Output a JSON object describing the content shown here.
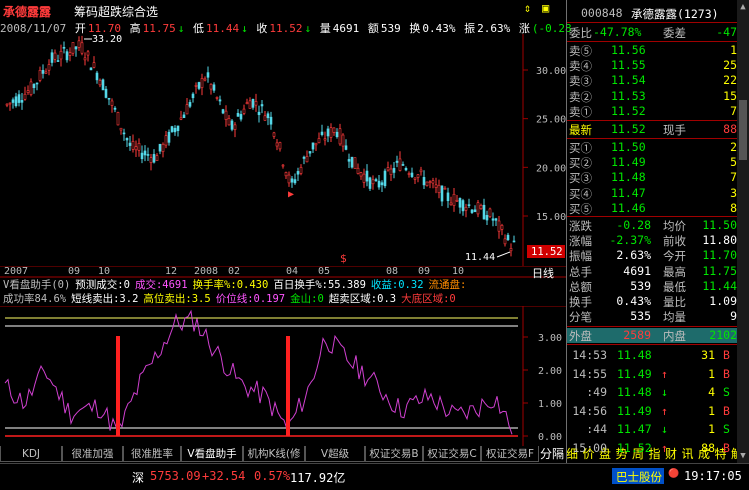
{
  "title": {
    "name": "承德露露",
    "indicator": "筹码超跌综合选"
  },
  "infobar": {
    "date": "2008/11/07",
    "open_label": "开",
    "open": "11.70",
    "high_label": "高",
    "high": "11.75",
    "low_label": "低",
    "low": "11.44",
    "close_label": "收",
    "close": "11.52",
    "vol_label": "量",
    "vol": "4691",
    "amt_label": "额",
    "amt": "539",
    "turn_label": "换",
    "turn": "0.43%",
    "amp_label": "振",
    "amp": "2.63%",
    "chg_label": "涨",
    "chg": "(-0.28"
  },
  "price_axis": [
    "30.00",
    "25.00",
    "20.00",
    "15.00"
  ],
  "price_marks": {
    "high_label": "33.20",
    "low_label": "11.44",
    "current_label": "11.52"
  },
  "date_axis": [
    "2007",
    "09",
    "10",
    "12",
    "2008",
    "02",
    "04",
    "05",
    "08",
    "09",
    "10"
  ],
  "period_label": "日线",
  "ind_info": {
    "line1": [
      {
        "t": "V看盘助手(0)",
        "c": "grey"
      },
      {
        "t": "预测成交:0",
        "c": "white"
      },
      {
        "t": "成交:4691",
        "c": "mag"
      },
      {
        "t": "换手率%:0.430",
        "c": "yellow"
      },
      {
        "t": "百日换手%:55.389",
        "c": "white"
      },
      {
        "t": "收益:0.32",
        "c": "cyan"
      },
      {
        "t": "流通盘:",
        "c": "orange"
      }
    ],
    "line2": [
      {
        "t": "成功率84.6%",
        "c": "grey"
      },
      {
        "t": "短线卖出:3.2",
        "c": "white"
      },
      {
        "t": "高位卖出:3.5",
        "c": "yellow"
      },
      {
        "t": "价位线:0.197",
        "c": "mag"
      },
      {
        "t": "金山:0",
        "c": "green"
      },
      {
        "t": "超卖区域:0.3",
        "c": "white"
      },
      {
        "t": "大底区域:0",
        "c": "red"
      }
    ]
  },
  "ind_axis": [
    "3.00",
    "2.00",
    "1.00",
    "0.00"
  ],
  "tabs": [
    "KDJ",
    "很准加强",
    "很准胜率",
    "V看盘助手",
    "机构K线(修",
    "V超级MACD",
    "权证交易B",
    "权证交易C",
    "权证交易F"
  ],
  "right_tabs": [
    "分隔",
    "细",
    "价",
    "盘",
    "势",
    "周",
    "指",
    "财",
    "讯",
    "成",
    "特",
    "解"
  ],
  "status": {
    "market": "深",
    "index": "5753.09",
    "change": "+32.54",
    "pct": "0.57%",
    "amount": "117.92亿",
    "ticker_name": "巴士股份",
    "time": "19:17:05"
  },
  "quote": {
    "code": "000848",
    "name": "承德露露(1273)",
    "weibi_label": "委比",
    "weibi": "-47.78%",
    "weicha_label": "委差",
    "weicha": "-47",
    "asks": [
      {
        "label": "卖⑤",
        "price": "11.56",
        "vol": "1"
      },
      {
        "label": "卖④",
        "price": "11.55",
        "vol": "25"
      },
      {
        "label": "卖③",
        "price": "11.54",
        "vol": "22"
      },
      {
        "label": "卖②",
        "price": "11.53",
        "vol": "15"
      },
      {
        "label": "卖①",
        "price": "11.52",
        "vol": "7"
      }
    ],
    "last_label": "最新",
    "last": "11.52",
    "curhand_label": "现手",
    "curhand": "88",
    "bids": [
      {
        "label": "买①",
        "price": "11.50",
        "vol": "2"
      },
      {
        "label": "买②",
        "price": "11.49",
        "vol": "5"
      },
      {
        "label": "买③",
        "price": "11.48",
        "vol": "7"
      },
      {
        "label": "买④",
        "price": "11.47",
        "vol": "3"
      },
      {
        "label": "买⑤",
        "price": "11.46",
        "vol": "8"
      }
    ],
    "stats": [
      {
        "l1": "涨跌",
        "v1": "-0.28",
        "l2": "均价",
        "v2": "11.50",
        "c1": "green",
        "c2": "green"
      },
      {
        "l1": "涨幅",
        "v1": "-2.37%",
        "l2": "前收",
        "v2": "11.80",
        "c1": "green",
        "c2": "white"
      },
      {
        "l1": "振幅",
        "v1": "2.63%",
        "l2": "今开",
        "v2": "11.70",
        "c1": "white",
        "c2": "green"
      },
      {
        "l1": "总手",
        "v1": "4691",
        "l2": "最高",
        "v2": "11.75",
        "c1": "white",
        "c2": "green"
      },
      {
        "l1": "总额",
        "v1": "539",
        "l2": "最低",
        "v2": "11.44",
        "c1": "white",
        "c2": "green"
      },
      {
        "l1": "换手",
        "v1": "0.43%",
        "l2": "量比",
        "v2": "1.09",
        "c1": "white",
        "c2": "white"
      },
      {
        "l1": "分笔",
        "v1": "535",
        "l2": "均量",
        "v2": "9",
        "c1": "white",
        "c2": "white"
      }
    ],
    "outer_label": "外盘",
    "outer": "2589",
    "inner_label": "内盘",
    "inner": "2102",
    "ticks": [
      {
        "t": "14:53",
        "p": "11.48",
        "a": "",
        "v": "31",
        "s": "B",
        "pc": "green",
        "sc": "red"
      },
      {
        "t": "14:55",
        "p": "11.49",
        "a": "↑",
        "v": "1",
        "s": "B",
        "pc": "green",
        "sc": "red"
      },
      {
        "t": ":49",
        "p": "11.48",
        "a": "↓",
        "v": "4",
        "s": "S",
        "pc": "green",
        "sc": "green"
      },
      {
        "t": "14:56",
        "p": "11.49",
        "a": "↑",
        "v": "1",
        "s": "B",
        "pc": "green",
        "sc": "red"
      },
      {
        "t": ":44",
        "p": "11.47",
        "a": "↓",
        "v": "1",
        "s": "S",
        "pc": "green",
        "sc": "green"
      },
      {
        "t": "15:00",
        "p": "11.52",
        "a": "↑",
        "v": "88",
        "s": "B",
        "pc": "green",
        "sc": "red"
      }
    ]
  }
}
